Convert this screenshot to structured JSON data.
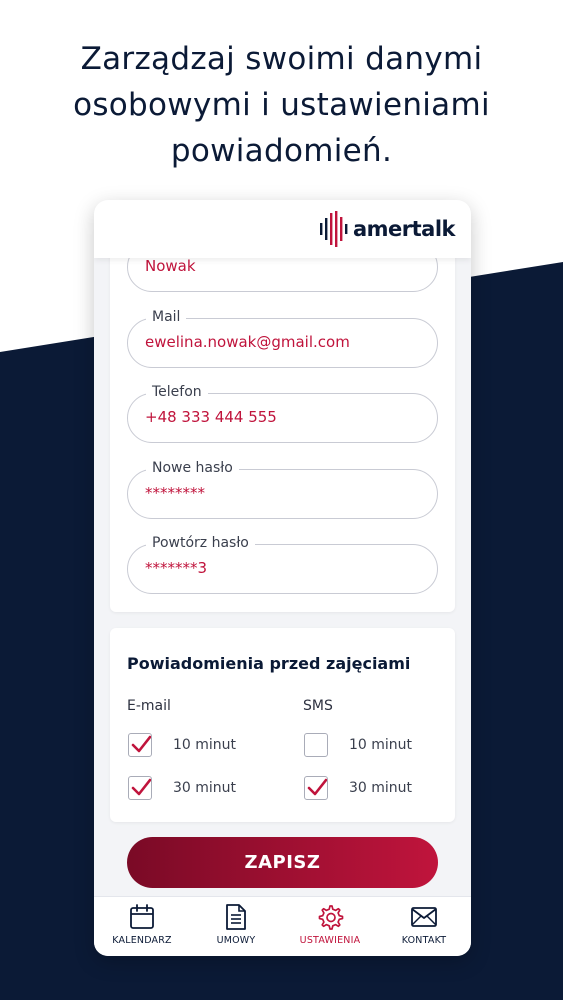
{
  "headline": {
    "line1": "Zarządzaj swoimi danymi",
    "line2": "osobowymi i ustawieniami",
    "line3": "powiadomień."
  },
  "app": {
    "logo_text": "amertalk",
    "colors": {
      "accent": "#c0143c",
      "navy": "#0b1a36"
    }
  },
  "form": {
    "surname": {
      "value": "Nowak"
    },
    "mail": {
      "label": "Mail",
      "value": "ewelina.nowak@gmail.com"
    },
    "phone": {
      "label": "Telefon",
      "value": "+48 333 444 555"
    },
    "new_password": {
      "label": "Nowe hasło",
      "value": "********"
    },
    "repeat_password": {
      "label": "Powtórz hasło",
      "value": "*******3"
    }
  },
  "notifications": {
    "title": "Powiadomienia przed zajęciami",
    "email_label": "E-mail",
    "sms_label": "SMS",
    "email": [
      {
        "label": "10 minut",
        "checked": true
      },
      {
        "label": "30 minut",
        "checked": true
      }
    ],
    "sms": [
      {
        "label": "10 minut",
        "checked": false
      },
      {
        "label": "30 minut",
        "checked": true
      }
    ]
  },
  "save_label": "ZAPISZ",
  "nav": [
    {
      "label": "KALENDARZ",
      "icon": "calendar-icon",
      "active": false
    },
    {
      "label": "UMOWY",
      "icon": "document-icon",
      "active": false
    },
    {
      "label": "USTAWIENIA",
      "icon": "gear-icon",
      "active": true
    },
    {
      "label": "KONTAKT",
      "icon": "envelope-icon",
      "active": false
    }
  ]
}
